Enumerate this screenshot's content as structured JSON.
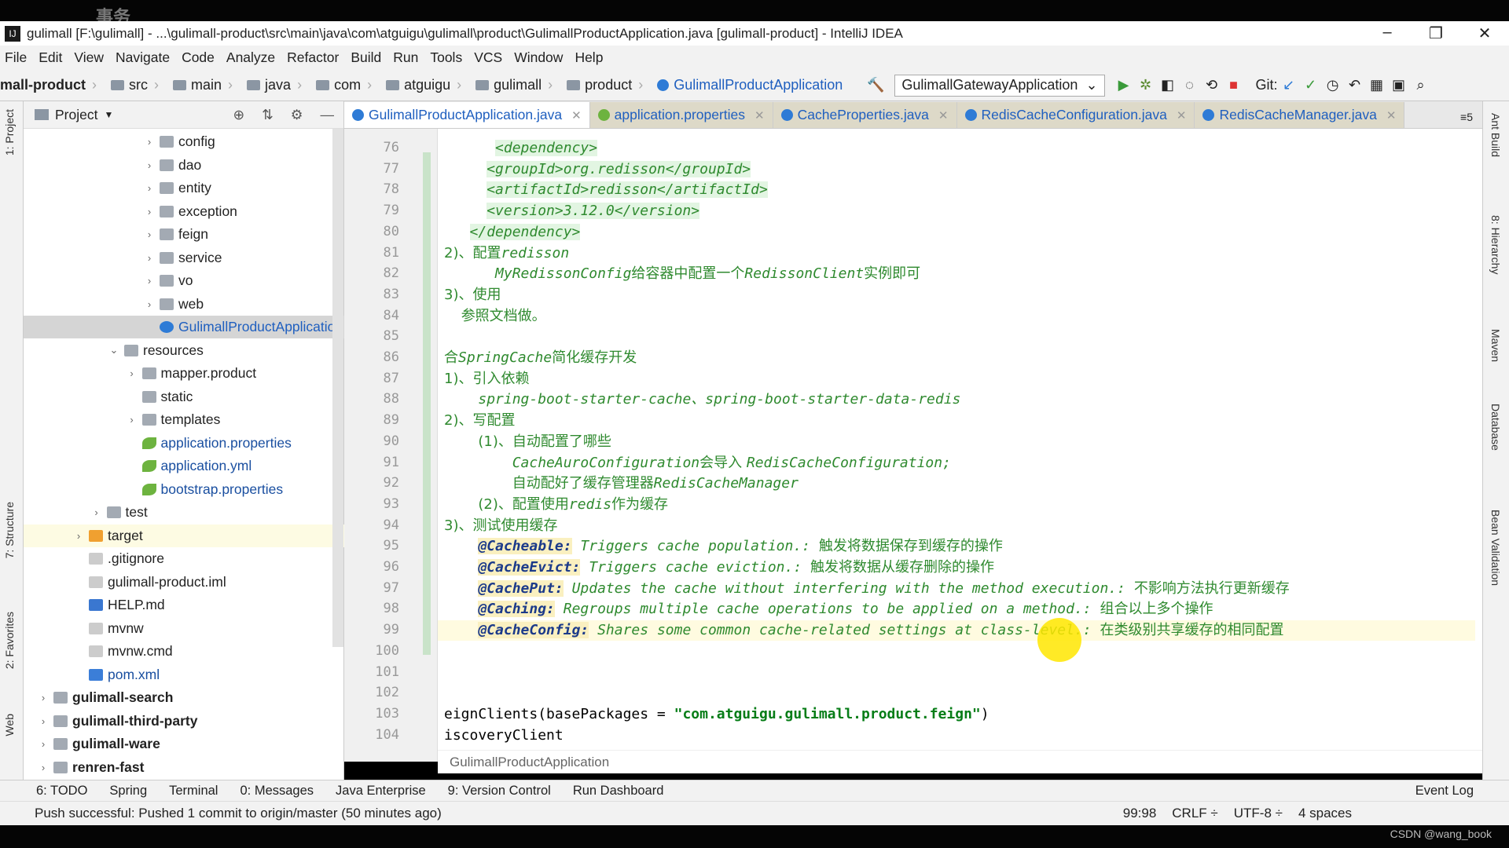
{
  "window": {
    "title": "gulimall [F:\\gulimall] - ...\\gulimall-product\\src\\main\\java\\com\\atguigu\\gulimall\\product\\GulimallProductApplication.java [gulimall-product] - IntelliJ IDEA",
    "logo": "IJ",
    "overlay": "事务"
  },
  "menu": [
    "File",
    "Edit",
    "View",
    "Navigate",
    "Code",
    "Analyze",
    "Refactor",
    "Build",
    "Run",
    "Tools",
    "VCS",
    "Window",
    "Help"
  ],
  "breadcrumb": [
    "mall-product",
    "src",
    "main",
    "java",
    "com",
    "atguigu",
    "gulimall",
    "product",
    "GulimallProductApplication"
  ],
  "run_config": "GulimallGatewayApplication",
  "git_label": "Git:",
  "project_panel": {
    "title": "Project"
  },
  "tree": [
    {
      "label": "config",
      "indent": 3,
      "arrow": "›",
      "icon": "folder"
    },
    {
      "label": "dao",
      "indent": 3,
      "arrow": "›",
      "icon": "folder"
    },
    {
      "label": "entity",
      "indent": 3,
      "arrow": "›",
      "icon": "folder"
    },
    {
      "label": "exception",
      "indent": 3,
      "arrow": "›",
      "icon": "folder"
    },
    {
      "label": "feign",
      "indent": 3,
      "arrow": "›",
      "icon": "folder"
    },
    {
      "label": "service",
      "indent": 3,
      "arrow": "›",
      "icon": "folder"
    },
    {
      "label": "vo",
      "indent": 3,
      "arrow": "›",
      "icon": "folder"
    },
    {
      "label": "web",
      "indent": 3,
      "arrow": "›",
      "icon": "folder"
    },
    {
      "label": "GulimallProductApplication",
      "indent": 3,
      "arrow": "",
      "icon": "java",
      "state": "selected"
    },
    {
      "label": "resources",
      "indent": 2,
      "arrow": "⌄",
      "icon": "folder"
    },
    {
      "label": "mapper.product",
      "indent": 2.5,
      "arrow": "›",
      "icon": "folder"
    },
    {
      "label": "static",
      "indent": 2.5,
      "arrow": "",
      "icon": "folder"
    },
    {
      "label": "templates",
      "indent": 2.5,
      "arrow": "›",
      "icon": "folder"
    },
    {
      "label": "application.properties",
      "indent": 2.5,
      "arrow": "",
      "icon": "spring"
    },
    {
      "label": "application.yml",
      "indent": 2.5,
      "arrow": "",
      "icon": "spring"
    },
    {
      "label": "bootstrap.properties",
      "indent": 2.5,
      "arrow": "",
      "icon": "spring"
    },
    {
      "label": "test",
      "indent": 1.5,
      "arrow": "›",
      "icon": "folder"
    },
    {
      "label": "target",
      "indent": 1,
      "arrow": "›",
      "icon": "orange",
      "state": "highlight"
    },
    {
      "label": ".gitignore",
      "indent": 1,
      "arrow": "",
      "icon": "file"
    },
    {
      "label": "gulimall-product.iml",
      "indent": 1,
      "arrow": "",
      "icon": "file"
    },
    {
      "label": "HELP.md",
      "indent": 1,
      "arrow": "",
      "icon": "md"
    },
    {
      "label": "mvnw",
      "indent": 1,
      "arrow": "",
      "icon": "file"
    },
    {
      "label": "mvnw.cmd",
      "indent": 1,
      "arrow": "",
      "icon": "file"
    },
    {
      "label": "pom.xml",
      "indent": 1,
      "arrow": "",
      "icon": "maven"
    },
    {
      "label": "gulimall-search",
      "indent": 0,
      "arrow": "›",
      "icon": "folder",
      "bold": true
    },
    {
      "label": "gulimall-third-party",
      "indent": 0,
      "arrow": "›",
      "icon": "folder",
      "bold": true
    },
    {
      "label": "gulimall-ware",
      "indent": 0,
      "arrow": "›",
      "icon": "folder",
      "bold": true
    },
    {
      "label": "renren-fast",
      "indent": 0,
      "arrow": "›",
      "icon": "folder",
      "bold": true
    }
  ],
  "tabs": [
    {
      "label": "GulimallProductApplication.java",
      "active": true,
      "icon": "java"
    },
    {
      "label": "application.properties",
      "icon": "spring"
    },
    {
      "label": "CacheProperties.java",
      "icon": "java"
    },
    {
      "label": "RedisCacheConfiguration.java",
      "icon": "java"
    },
    {
      "label": "RedisCacheManager.java",
      "icon": "java"
    }
  ],
  "tabs_overflow": "≡5",
  "code": [
    {
      "n": "76",
      "indent": "      ",
      "segs": [
        {
          "t": "<dependency>",
          "k": "tag"
        }
      ]
    },
    {
      "n": "77",
      "indent": "     ",
      "segs": [
        {
          "t": "<groupId>org.redisson</groupId>",
          "k": "tag"
        }
      ]
    },
    {
      "n": "78",
      "indent": "     ",
      "segs": [
        {
          "t": "<artifactId>redisson</artifactId>",
          "k": "tag"
        }
      ]
    },
    {
      "n": "79",
      "indent": "     ",
      "segs": [
        {
          "t": "<version>3.12.0</version>",
          "k": "tag"
        }
      ]
    },
    {
      "n": "80",
      "indent": "   ",
      "segs": [
        {
          "t": "</dependency>",
          "k": "tag"
        }
      ]
    },
    {
      "n": "81",
      "indent": "",
      "segs": [
        {
          "t": "2)、配置",
          "k": "cn"
        },
        {
          "t": "redisson",
          "k": "text"
        }
      ]
    },
    {
      "n": "82",
      "indent": "      ",
      "segs": [
        {
          "t": "MyRedissonConfig",
          "k": "text"
        },
        {
          "t": "给容器中配置一个",
          "k": "cn"
        },
        {
          "t": "RedissonClient",
          "k": "text"
        },
        {
          "t": "实例即可",
          "k": "cn"
        }
      ]
    },
    {
      "n": "83",
      "indent": "",
      "segs": [
        {
          "t": "3)、使用",
          "k": "cn"
        }
      ]
    },
    {
      "n": "84",
      "indent": "  ",
      "segs": [
        {
          "t": "参照文档做。",
          "k": "cn"
        }
      ]
    },
    {
      "n": "85",
      "indent": "",
      "segs": []
    },
    {
      "n": "86",
      "indent": "",
      "segs": [
        {
          "t": "合",
          "k": "cn"
        },
        {
          "t": "SpringCache",
          "k": "text"
        },
        {
          "t": "简化缓存开发",
          "k": "cn"
        }
      ]
    },
    {
      "n": "87",
      "indent": "",
      "segs": [
        {
          "t": "1)、引入依赖",
          "k": "cn"
        }
      ]
    },
    {
      "n": "88",
      "indent": "    ",
      "segs": [
        {
          "t": "spring-boot-starter-cache、spring-boot-starter-data-redis",
          "k": "text"
        }
      ]
    },
    {
      "n": "89",
      "indent": "",
      "segs": [
        {
          "t": "2)、写配置",
          "k": "cn"
        }
      ]
    },
    {
      "n": "90",
      "indent": "    ",
      "segs": [
        {
          "t": "(1)、自动配置了哪些",
          "k": "cn"
        }
      ]
    },
    {
      "n": "91",
      "indent": "        ",
      "segs": [
        {
          "t": "CacheAuroConfiguration",
          "k": "text"
        },
        {
          "t": "会导入 ",
          "k": "cn"
        },
        {
          "t": "RedisCacheConfiguration;",
          "k": "text"
        }
      ]
    },
    {
      "n": "92",
      "indent": "        ",
      "segs": [
        {
          "t": "自动配好了缓存管理器",
          "k": "cn"
        },
        {
          "t": "RedisCacheManager",
          "k": "text"
        }
      ]
    },
    {
      "n": "93",
      "indent": "    ",
      "segs": [
        {
          "t": "(2)、配置使用",
          "k": "cn"
        },
        {
          "t": "redis",
          "k": "text"
        },
        {
          "t": "作为缓存",
          "k": "cn"
        }
      ]
    },
    {
      "n": "94",
      "indent": "",
      "segs": [
        {
          "t": "3)、测试使用缓存",
          "k": "cn"
        }
      ]
    },
    {
      "n": "95",
      "indent": "    ",
      "segs": [
        {
          "t": "@Cacheable:",
          "k": "ann"
        },
        {
          "t": " Triggers cache population.: ",
          "k": "text"
        },
        {
          "t": "触发将数据保存到缓存的操作",
          "k": "cn"
        }
      ]
    },
    {
      "n": "96",
      "indent": "    ",
      "segs": [
        {
          "t": "@CacheEvict:",
          "k": "ann"
        },
        {
          "t": " Triggers cache eviction.: ",
          "k": "text"
        },
        {
          "t": "触发将数据从缓存删除的操作",
          "k": "cn"
        }
      ]
    },
    {
      "n": "97",
      "indent": "    ",
      "segs": [
        {
          "t": "@CachePut:",
          "k": "ann"
        },
        {
          "t": " Updates the cache without interfering with the method execution.: ",
          "k": "text"
        },
        {
          "t": "不影响方法执行更新缓存",
          "k": "cn"
        }
      ]
    },
    {
      "n": "98",
      "indent": "    ",
      "segs": [
        {
          "t": "@Caching:",
          "k": "ann"
        },
        {
          "t": " Regroups multiple cache operations to be applied on a method.: ",
          "k": "text"
        },
        {
          "t": "组合以上多个操作",
          "k": "cn"
        }
      ]
    },
    {
      "n": "99",
      "indent": "    ",
      "segs": [
        {
          "t": "@CacheConfig:",
          "k": "ann"
        },
        {
          "t": " Shares some common cache-related settings at class-level.: ",
          "k": "text"
        },
        {
          "t": "在类级别共享缓存的相同配置",
          "k": "cn"
        }
      ],
      "current": true
    },
    {
      "n": "100",
      "indent": "",
      "segs": []
    },
    {
      "n": "101",
      "indent": "",
      "segs": []
    },
    {
      "n": "102",
      "indent": "",
      "segs": []
    },
    {
      "n": "103",
      "indent": "",
      "segs": [
        {
          "t": "eignClients(basePackages = ",
          "k": "code"
        },
        {
          "t": "\"com.atguigu.gulimall.product.feign\"",
          "k": "str"
        },
        {
          "t": ")",
          "k": "code"
        }
      ]
    },
    {
      "n": "104",
      "indent": "",
      "segs": [
        {
          "t": "iscoveryClient",
          "k": "code"
        }
      ]
    }
  ],
  "editor_breadcrumb": "GulimallProductApplication",
  "left_tabs": [
    "1: Project",
    "7: Structure",
    "2: Favorites",
    "Web"
  ],
  "right_tabs": [
    "Ant Build",
    "8: Hierarchy",
    "Maven",
    "Database",
    "Bean Validation"
  ],
  "tool_windows": [
    "6: TODO",
    "Spring",
    "Terminal",
    "0: Messages",
    "Java Enterprise",
    "9: Version Control",
    "Run Dashboard"
  ],
  "event_log": "Event Log",
  "status": {
    "message": "Push successful: Pushed 1 commit to origin/master (50 minutes ago)",
    "position": "99:98",
    "line_sep": "CRLF ÷",
    "encoding": "UTF-8 ÷",
    "indent": "4 spaces"
  },
  "watermark": "CSDN @wang_book"
}
